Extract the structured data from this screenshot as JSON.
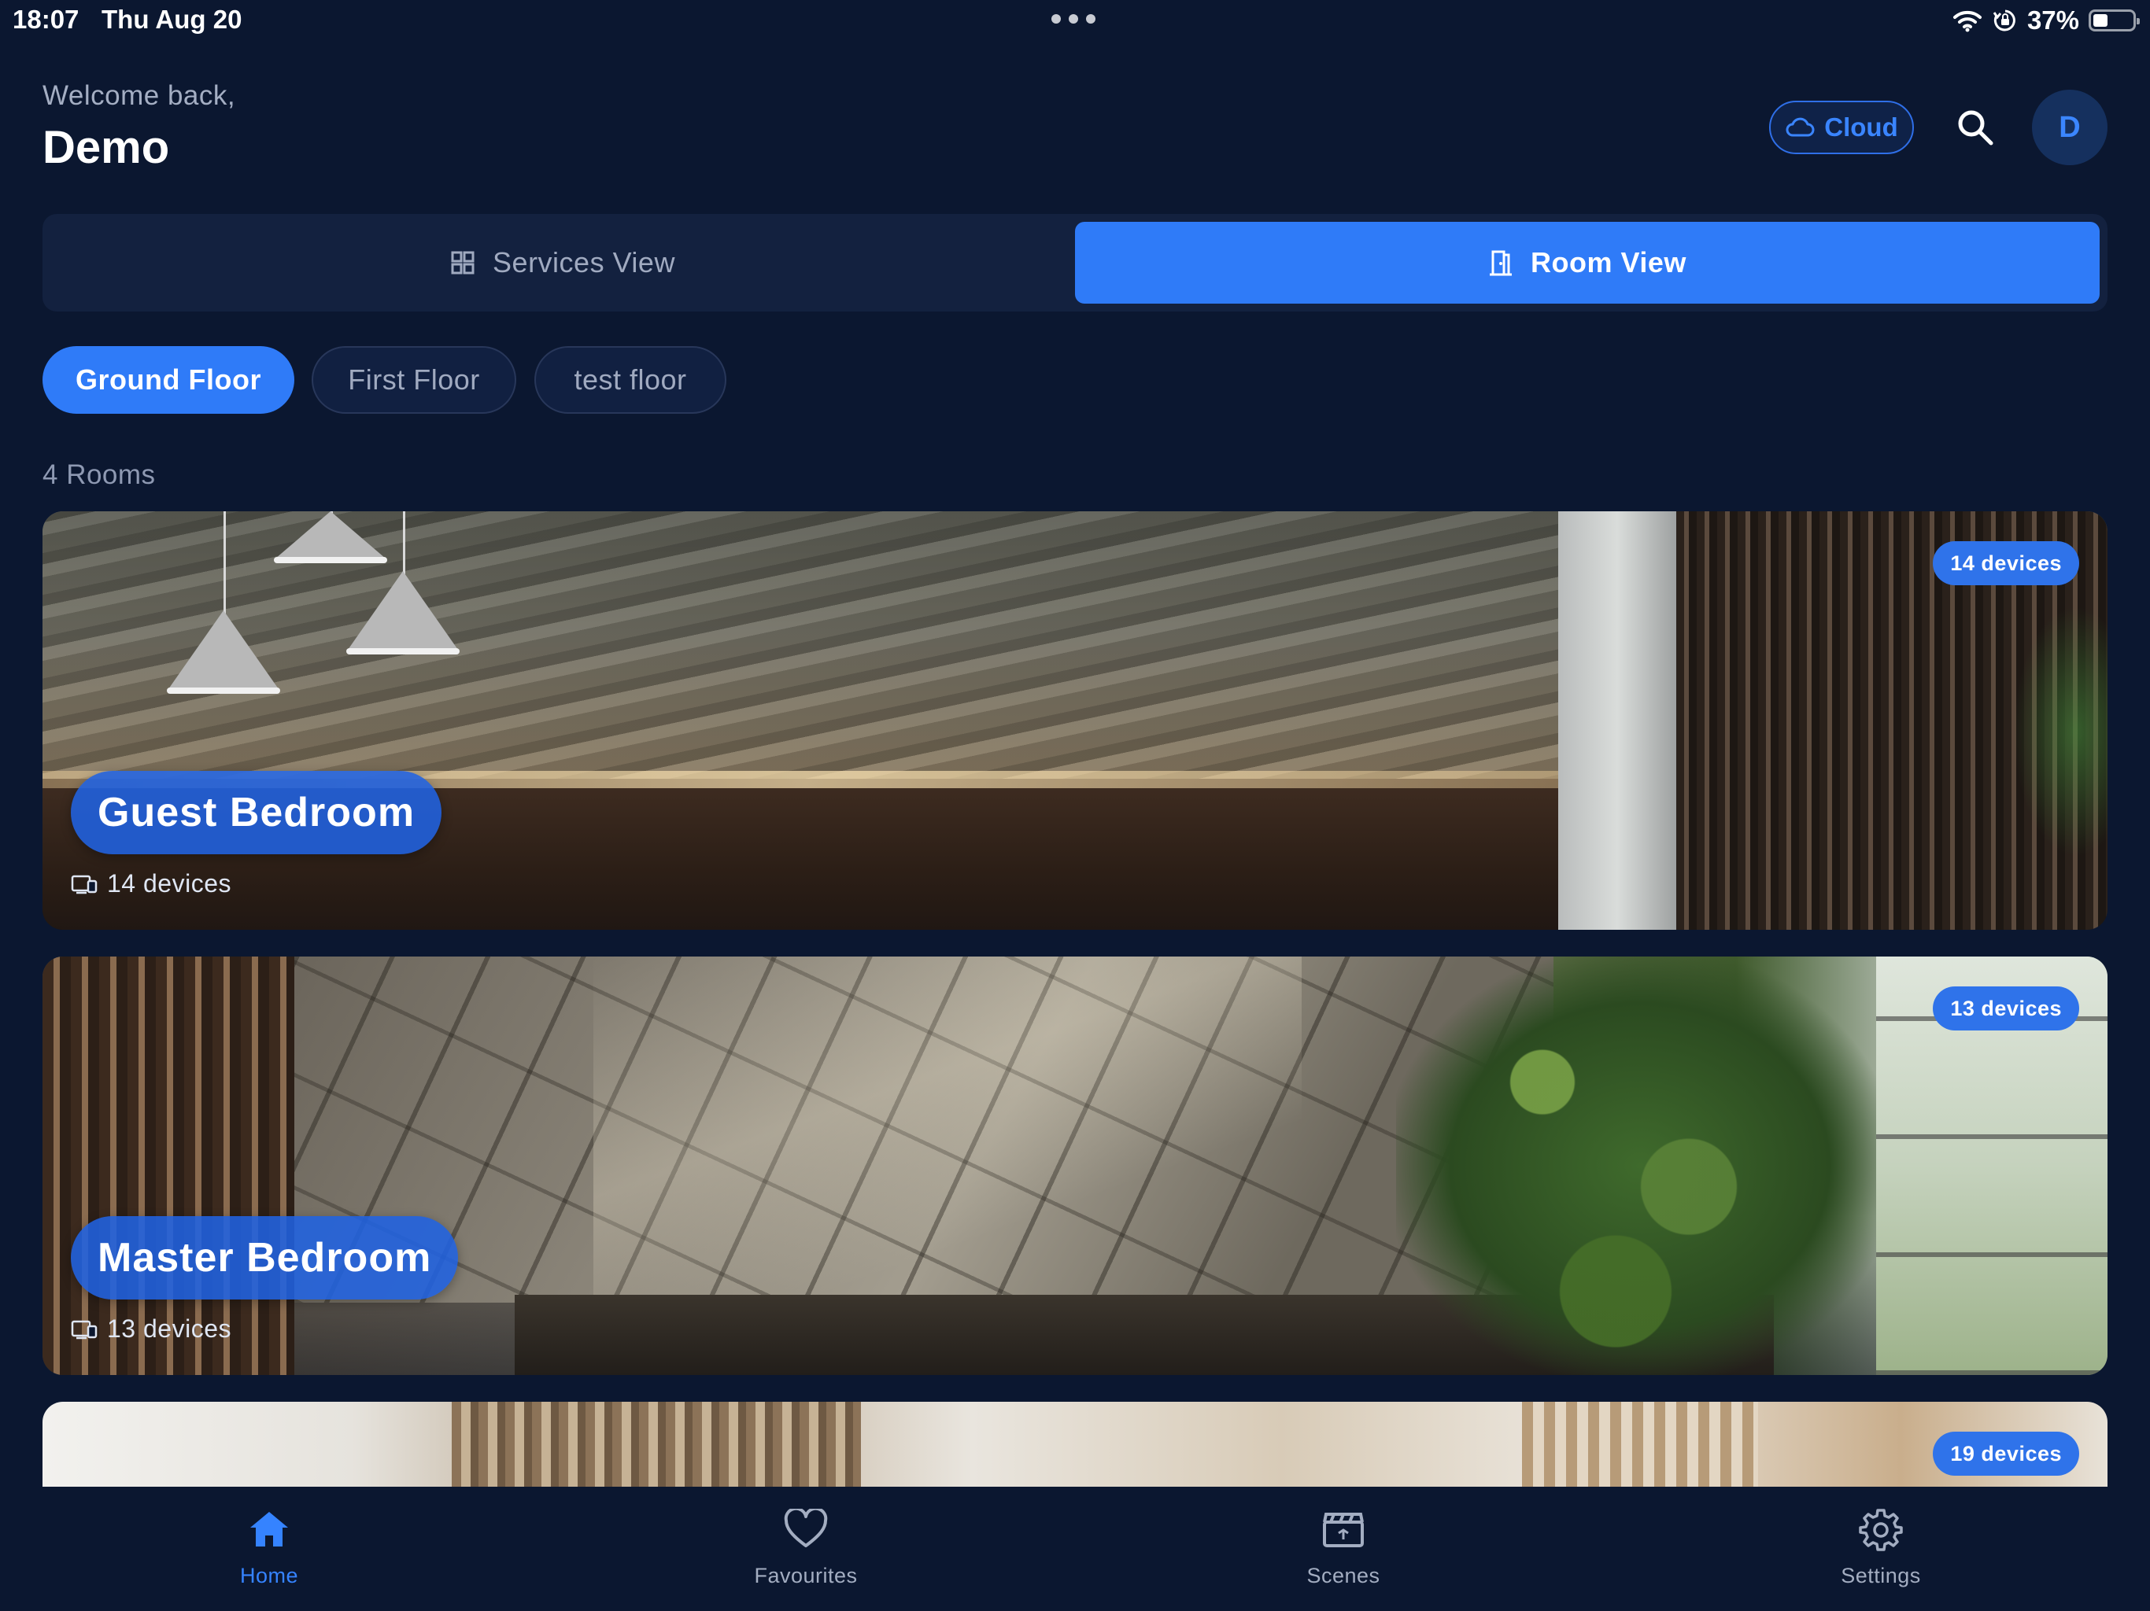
{
  "status_bar": {
    "time": "18:07",
    "date": "Thu Aug 20",
    "battery": "37%",
    "battery_level": 0.37
  },
  "header": {
    "welcome": "Welcome back,",
    "user_name": "Demo",
    "cloud_label": "Cloud",
    "avatar_initial": "D"
  },
  "view_toggle": {
    "services_label": "Services View",
    "room_label": "Room View",
    "selected": "Room View"
  },
  "floors": {
    "ground": "Ground Floor",
    "first": "First Floor",
    "test": "test floor",
    "selected": "Ground Floor"
  },
  "rooms_count": "4 Rooms",
  "rooms": [
    {
      "name": "Guest Bedroom",
      "badge": "14 devices",
      "devices": "14 devices"
    },
    {
      "name": "Master Bedroom",
      "badge": "13 devices",
      "devices": "13 devices"
    },
    {
      "name": "",
      "badge": "19 devices",
      "devices": ""
    }
  ],
  "nav": {
    "home": "Home",
    "favourites": "Favourites",
    "scenes": "Scenes",
    "settings": "Settings",
    "active": "Home"
  },
  "colors": {
    "background": "#0b1730",
    "accent": "#2f7bf8",
    "muted_text": "#a0aac0"
  },
  "icons": {
    "wifi": "wifi-icon",
    "orientation_lock": "orientation-lock-icon",
    "battery": "battery-icon",
    "cloud": "cloud-icon",
    "search": "search-icon",
    "services": "grid-icon",
    "room": "door-icon",
    "devices": "devices-icon",
    "home": "home-icon",
    "favourites": "heart-icon",
    "scenes": "clapperboard-icon",
    "settings": "gear-icon"
  }
}
